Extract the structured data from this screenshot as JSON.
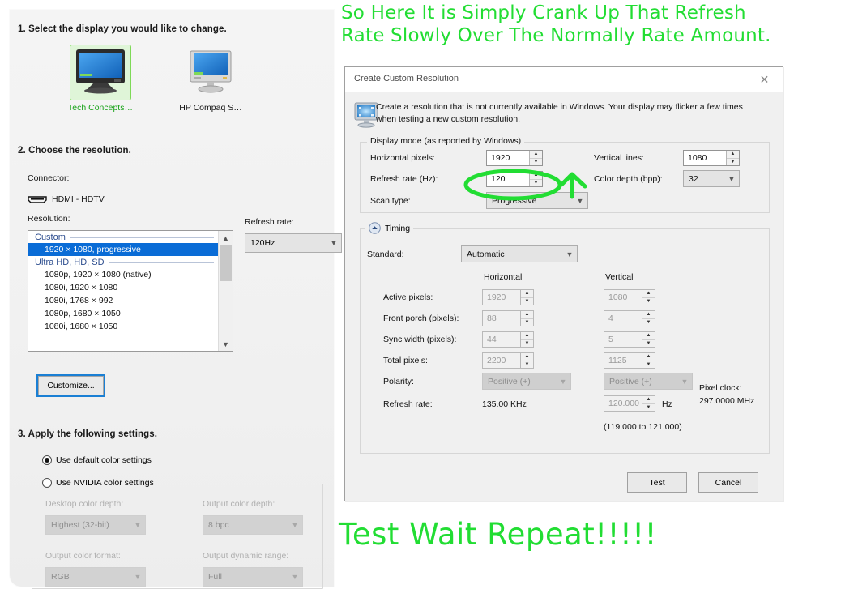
{
  "nvidia_panel": {
    "step1_title": "1. Select the display you would like to change.",
    "step2_title": "2. Choose the resolution.",
    "step3_title": "3. Apply the following settings.",
    "displays": [
      {
        "label": "Tech Concepts…",
        "selected": true
      },
      {
        "label": "HP Compaq S…",
        "selected": false
      }
    ],
    "connector_label": "Connector:",
    "connector_value": "HDMI - HDTV",
    "resolution_label": "Resolution:",
    "refresh_rate_label": "Refresh rate:",
    "refresh_rate_value": "120Hz",
    "resolution_groups": [
      {
        "group": "Custom",
        "items": [
          {
            "text": "1920 × 1080, progressive",
            "selected": true
          }
        ]
      },
      {
        "group": "Ultra HD, HD, SD",
        "items": [
          {
            "text": "1080p, 1920 × 1080 (native)",
            "selected": false
          },
          {
            "text": "1080i, 1920 × 1080",
            "selected": false
          },
          {
            "text": "1080i, 1768 × 992",
            "selected": false
          },
          {
            "text": "1080p, 1680 × 1050",
            "selected": false
          },
          {
            "text": "1080i, 1680 × 1050",
            "selected": false
          }
        ]
      }
    ],
    "customize_button": "Customize...",
    "color_mode_default": "Use default color settings",
    "color_mode_nvidia": "Use NVIDIA color settings",
    "color_fields": [
      {
        "label": "Desktop color depth:",
        "value": "Highest (32-bit)"
      },
      {
        "label": "Output color depth:",
        "value": "8 bpc"
      },
      {
        "label": "Output color format:",
        "value": "RGB"
      },
      {
        "label": "Output dynamic range:",
        "value": "Full"
      }
    ]
  },
  "dialog": {
    "title": "Create Custom Resolution",
    "close_label": "✕",
    "info_text": "Create a resolution that is not currently available in Windows. Your display may flicker a few times when testing a new custom resolution.",
    "display_mode": {
      "group_title": "Display mode (as reported by Windows)",
      "horizontal_pixels_label": "Horizontal pixels:",
      "horizontal_pixels_value": "1920",
      "vertical_lines_label": "Vertical lines:",
      "vertical_lines_value": "1080",
      "refresh_rate_label": "Refresh rate (Hz):",
      "refresh_rate_value": "120",
      "color_depth_label": "Color depth (bpp):",
      "color_depth_value": "32",
      "scan_type_label": "Scan type:",
      "scan_type_value": "Progressive"
    },
    "timing": {
      "group_title": "Timing",
      "standard_label": "Standard:",
      "standard_value": "Automatic",
      "col_horizontal": "Horizontal",
      "col_vertical": "Vertical",
      "rows": [
        {
          "label": "Active pixels:",
          "h": "1920",
          "v": "1080"
        },
        {
          "label": "Front porch (pixels):",
          "h": "88",
          "v": "4"
        },
        {
          "label": "Sync width (pixels):",
          "h": "44",
          "v": "5"
        },
        {
          "label": "Total pixels:",
          "h": "2200",
          "v": "1125"
        },
        {
          "label": "Polarity:",
          "h": "Positive (+)",
          "v": "Positive (+)"
        }
      ],
      "refresh_rate_label": "Refresh rate:",
      "refresh_rate_h": "135.00 KHz",
      "refresh_rate_v": "120.000",
      "refresh_rate_unit": "Hz",
      "refresh_rate_range": "(119.000 to 121.000)",
      "pixel_clock_label": "Pixel clock:",
      "pixel_clock_value": "297.0000 MHz"
    },
    "buttons": {
      "test": "Test",
      "cancel": "Cancel"
    }
  },
  "annotations": {
    "top": "So Here It is Simply Crank Up That Refresh\nRate Slowly Over The Normally Rate Amount.",
    "bottom": "Test Wait Repeat!!!!!",
    "color": "#22dd33"
  }
}
